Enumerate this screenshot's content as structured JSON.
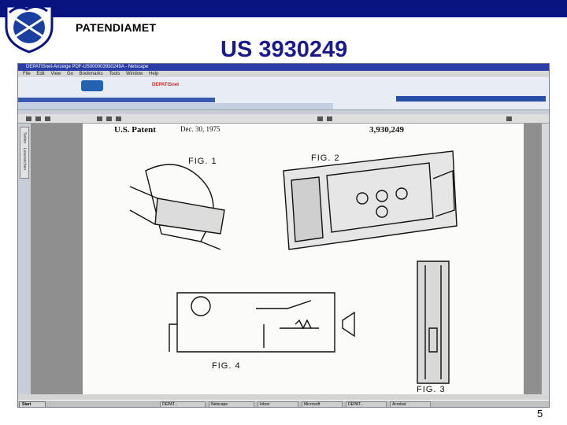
{
  "brand": "PATENDIAMET",
  "patent_number": "US 3930249",
  "slide_number": "5",
  "screenshot": {
    "window_title": "DEPATISnet-Anzeige PDF-US000003930249A - Netscape",
    "menu": [
      "File",
      "Edit",
      "View",
      "Go",
      "Bookmarks",
      "Tools",
      "Window",
      "Help"
    ],
    "depatis_label": "DEPATISnet",
    "patent_header_left": "U.S. Patent",
    "patent_header_date": "Dec. 30, 1975",
    "patent_header_number": "3,930,249",
    "figures": [
      "FIG. 1",
      "FIG. 2",
      "FIG. 3",
      "FIG. 4"
    ],
    "side_tabs": [
      "Seiten",
      "Lesezeichen"
    ],
    "start_button": "Start",
    "task_items": [
      "DEPAT...",
      "Netscape",
      "Inbox",
      "Microsoft",
      "DEPAT...",
      "Acrobat"
    ]
  }
}
